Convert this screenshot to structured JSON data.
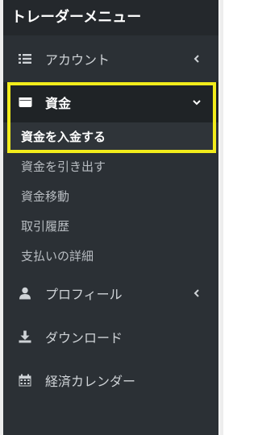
{
  "menu": {
    "title": "トレーダーメニュー"
  },
  "items": [
    {
      "label": "アカウント",
      "icon": "list-icon",
      "chevron": "chevron-left"
    },
    {
      "label": "資金",
      "icon": "wallet-icon",
      "chevron": "chevron-down",
      "active": true
    },
    {
      "label": "プロフィール",
      "icon": "user-icon",
      "chevron": "chevron-left"
    },
    {
      "label": "ダウンロード",
      "icon": "download-icon"
    },
    {
      "label": "経済カレンダー",
      "icon": "calendar-icon"
    }
  ],
  "funds_submenu": [
    {
      "label": "資金を入金する",
      "current": true
    },
    {
      "label": "資金を引き出す"
    },
    {
      "label": "資金移動"
    },
    {
      "label": "取引履歴"
    },
    {
      "label": "支払いの詳細"
    }
  ],
  "colors": {
    "sidebar_bg": "#2b3035",
    "header_bg": "#24282c",
    "active_bg": "#1f2326",
    "highlight_border": "#f2ec1b",
    "text": "#cfd3d7",
    "subtext": "#b8bdc2"
  }
}
